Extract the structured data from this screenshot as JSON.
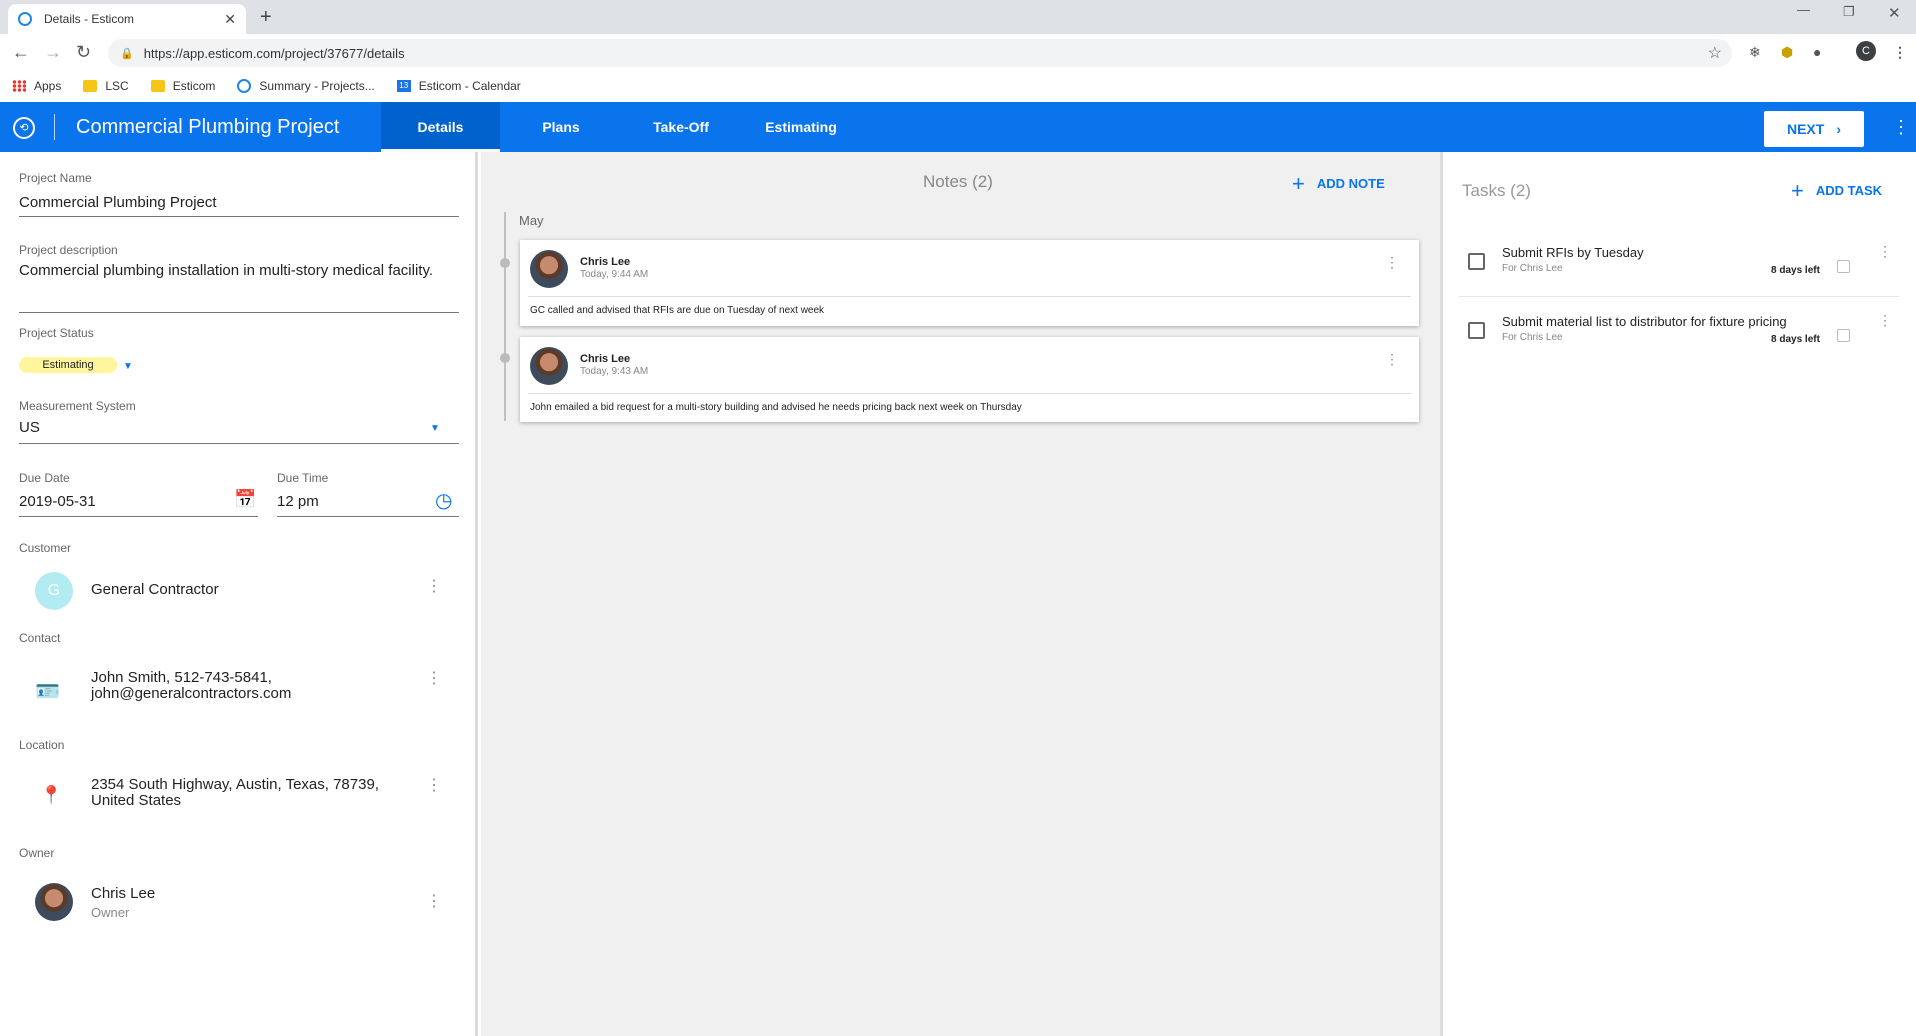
{
  "browser": {
    "tab_title": "Details - Esticom",
    "url": "https://app.esticom.com/project/37677/details",
    "profile_initial": "C",
    "bookmarks": [
      {
        "label": "Apps",
        "icon": "apps-grid-icon"
      },
      {
        "label": "LSC",
        "icon": "folder-icon"
      },
      {
        "label": "Esticom",
        "icon": "folder-icon"
      },
      {
        "label": "Summary - Projects...",
        "icon": "esticom-icon"
      },
      {
        "label": "Esticom - Calendar",
        "icon": "calendar-icon"
      }
    ],
    "calendar_day": "13"
  },
  "appbar": {
    "title": "Commercial Plumbing Project",
    "tabs": [
      {
        "label": "Details",
        "active": true
      },
      {
        "label": "Plans",
        "active": false
      },
      {
        "label": "Take-Off",
        "active": false
      },
      {
        "label": "Estimating",
        "active": false
      }
    ],
    "next_label": "NEXT",
    "accent": "#0a74ec"
  },
  "details": {
    "project_name_label": "Project Name",
    "project_name": "Commercial Plumbing Project",
    "description_label": "Project description",
    "description": "Commercial plumbing installation in multi-story medical facility.",
    "status_label": "Project Status",
    "status": "Estimating",
    "measurement_label": "Measurement System",
    "measurement": "US",
    "due_date_label": "Due Date",
    "due_date": "2019-05-31",
    "due_time_label": "Due Time",
    "due_time": "12 pm",
    "customer_label": "Customer",
    "customer_initial": "G",
    "customer": "General Contractor",
    "contact_label": "Contact",
    "contact_line1": "John Smith, 512-743-5841,",
    "contact_line2": "john@generalcontractors.com",
    "location_label": "Location",
    "location_line1": "2354 South Highway, Austin, Texas, 78739,",
    "location_line2": "United States",
    "owner_label": "Owner",
    "owner_name": "Chris Lee",
    "owner_role": "Owner"
  },
  "notes": {
    "title": "Notes (2)",
    "add_label": "ADD NOTE",
    "month": "May",
    "items": [
      {
        "author": "Chris Lee",
        "time": "Today, 9:44 AM",
        "text": "GC called and advised that RFIs are due on Tuesday of next week"
      },
      {
        "author": "Chris Lee",
        "time": "Today, 9:43 AM",
        "text": "John emailed a bid request for a multi-story building and advised he needs pricing back next week on Thursday"
      }
    ]
  },
  "tasks": {
    "title": "Tasks (2)",
    "add_label": "ADD TASK",
    "items": [
      {
        "title": "Submit RFIs by Tuesday",
        "for": "For Chris Lee",
        "due": "8 days left"
      },
      {
        "title": "Submit material list to distributor for fixture pricing",
        "for": "For Chris Lee",
        "due": "8 days left"
      }
    ]
  }
}
